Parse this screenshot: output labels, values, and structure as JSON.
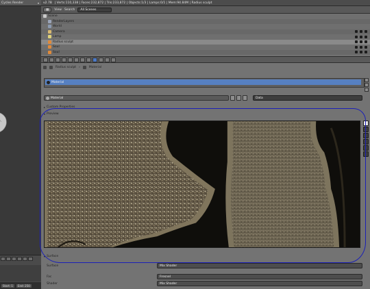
{
  "viewport": {
    "render_engine": "Cycles Render",
    "timeline": {
      "frame_start": "Start: 1",
      "frame_end": "End: 250"
    }
  },
  "info_header": {
    "version": "v2.78",
    "stats": "| Verts:110,338 | Faces:232,872 | Tris:233,872 | Objects:1/3 | Lamps:0/1 | Mem:94.84M | Radius sculpt"
  },
  "outliner_header": {
    "view_label": "View",
    "search_label": "Search",
    "scenes_select": "All Scenes"
  },
  "outliner": {
    "items": [
      {
        "label": "Scene",
        "icon_color": "#c9c9c9"
      },
      {
        "label": "RenderLayers",
        "icon_color": "#9aa4b8"
      },
      {
        "label": "World",
        "icon_color": "#8c9bb2"
      },
      {
        "label": "Camera",
        "icon_color": "#d8b870"
      },
      {
        "label": "Lamp",
        "icon_color": "#e0d27a"
      },
      {
        "label": "Radius sculpt",
        "icon_color": "#e08a3a",
        "selected": true
      },
      {
        "label": "Soul",
        "icon_color": "#e08a3a"
      },
      {
        "label": "Soul",
        "icon_color": "#e08a3a"
      }
    ]
  },
  "properties": {
    "breadcrumb": [
      "Radius sculpt",
      "Material"
    ],
    "slot_name": "Material",
    "material_name": "Material",
    "data_select": "Data",
    "custom_properties_label": "Custom Properties",
    "preview_label": "Preview",
    "surface_label": "Surface",
    "surface_rows": [
      {
        "label": "Surface",
        "value": "Mix Shader"
      },
      {
        "label": "Fac",
        "value": "Fresnel"
      },
      {
        "label": "Shader",
        "value": "Mix Shader"
      }
    ]
  },
  "colors": {
    "selection_blue": "#5680c2",
    "annotation_ink": "#1a1fb8",
    "panel_gray": "#737373"
  },
  "icons": [
    "sphere-preview-icon",
    "cube-preview-icon",
    "monkey-preview-icon",
    "hair-preview-icon",
    "sky-preview-icon",
    "world-preview-icon"
  ]
}
